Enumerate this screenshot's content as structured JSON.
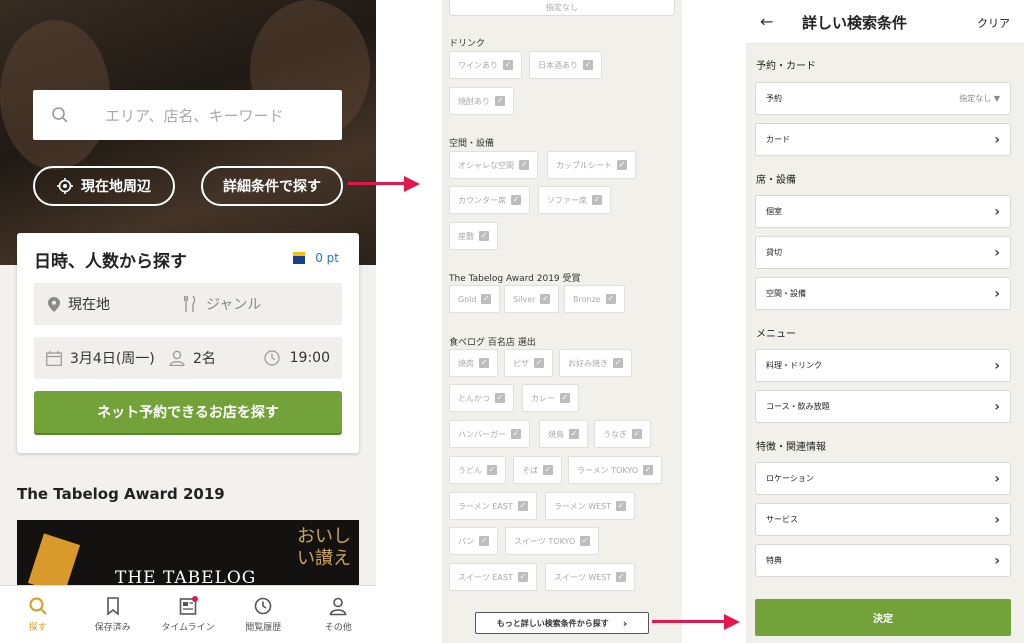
{
  "screen1": {
    "search_placeholder": "エリア、店名、キーワード",
    "btn_location": "現在地周辺",
    "btn_detail": "詳細条件で探す",
    "card_title": "日時、人数から探す",
    "points": "0 pt",
    "location": "現在地",
    "genre": "ジャンル",
    "date": "3月4日(周一)",
    "people": "2名",
    "time": "19:00",
    "reserve_btn": "ネット予約できるお店を探す",
    "award_title": "The Tabelog Award 2019",
    "banner_text": "THE TABELOG",
    "banner_jp": "おいしい讃え",
    "tabs": [
      {
        "label": "探す",
        "icon": "search-icon"
      },
      {
        "label": "保存済み",
        "icon": "bookmark-icon"
      },
      {
        "label": "タイムライン",
        "icon": "timeline-icon"
      },
      {
        "label": "閲覧履歴",
        "icon": "history-icon"
      },
      {
        "label": "その他",
        "icon": "person-icon"
      }
    ]
  },
  "screen2": {
    "top_select": "指定なし",
    "drink_header": "ドリンク",
    "drink": [
      "ワインあり",
      "日本酒あり",
      "焼酎あり"
    ],
    "facility_header": "空間・設備",
    "facility": [
      "オシャレな空間",
      "カップルシート",
      "カウンター席",
      "ソファー席",
      "座敷"
    ],
    "award_header": "The Tabelog Award 2019 受賞",
    "award": [
      "Gold",
      "Silver",
      "Bronze"
    ],
    "hyakumeiten_header": "食べログ 百名店 選出",
    "hyakumeiten": [
      "焼肉",
      "ピザ",
      "お好み焼き",
      "とんかつ",
      "カレー",
      "ハンバーガー",
      "焼鳥",
      "うなぎ",
      "うどん",
      "そば",
      "ラーメン TOKYO",
      "ラーメン EAST",
      "ラーメン WEST",
      "パン",
      "スイーツ TOKYO",
      "スイーツ EAST",
      "スイーツ WEST"
    ],
    "more_btn": "もっと詳しい検索条件から探す"
  },
  "screen3": {
    "title": "詳しい検索条件",
    "clear": "クリア",
    "sec_reserve": "予約・カード",
    "reserve": "予約",
    "reserve_value": "指定なし",
    "card": "カード",
    "sec_seat": "席・設備",
    "private_room": "個室",
    "charter": "貸切",
    "space": "空間・設備",
    "sec_menu": "メニュー",
    "food_drink": "料理・ドリンク",
    "course": "コース・飲み放題",
    "sec_feature": "特徴・関連情報",
    "location": "ロケーション",
    "service": "サービス",
    "benefit": "特典",
    "decide": "決定"
  },
  "colors": {
    "accent_green": "#74a23a",
    "arrow_red": "#e3174b",
    "tab_active": "#e19a16"
  }
}
